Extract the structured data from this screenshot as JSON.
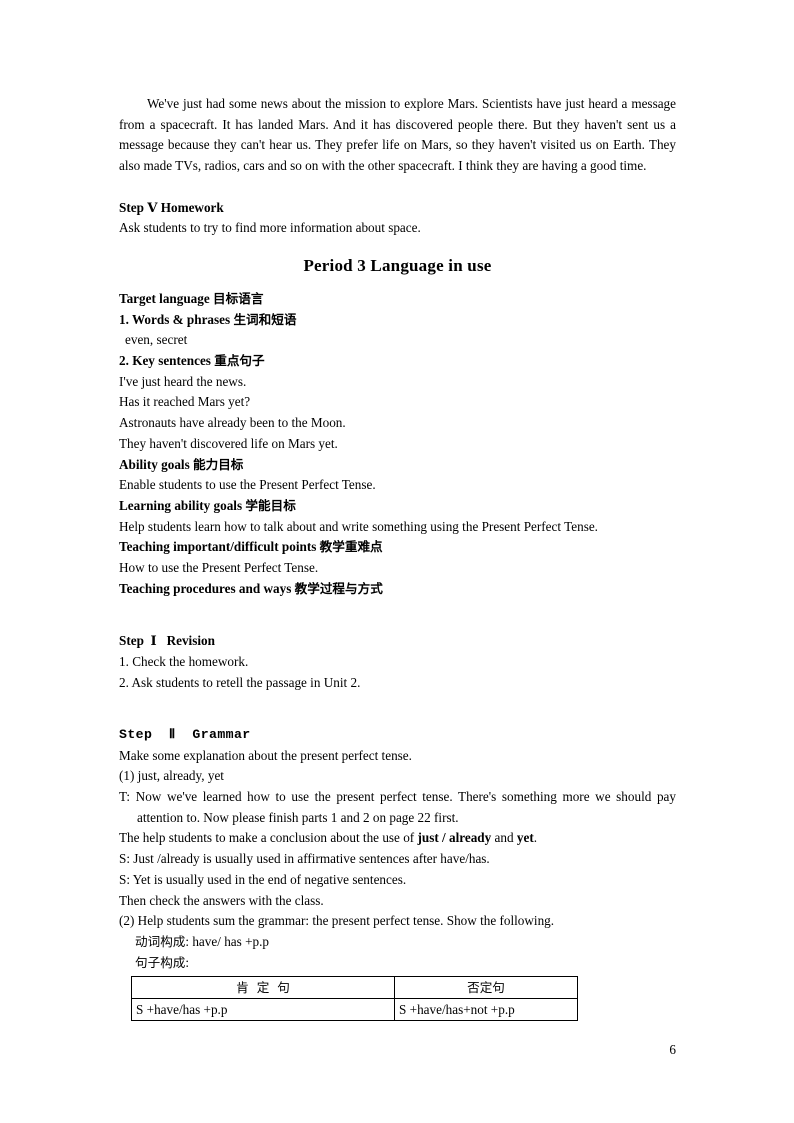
{
  "document": {
    "page_number": "6",
    "intro_paragraph": "We've just had some news about the mission to explore Mars. Scientists have just heard a message from a spacecraft. It has landed Mars. And it has discovered people there. But they haven't sent us a message because they can't hear us. They prefer life on Mars, so they haven't visited us on Earth. They also made TVs, radios, cars and so on with the other spacecraft. I think they are having a good time.",
    "step5": {
      "heading": "Step Ⅴ Homework",
      "body": "Ask students to try to find more information about space."
    },
    "period_title": "Period 3 Language in use",
    "target_language": {
      "heading_en": "Target language ",
      "heading_cn": "目标语言",
      "words_phrases": {
        "heading_en": "1. Words & phrases ",
        "heading_cn": "生词和短语",
        "items": "even, secret"
      },
      "key_sentences": {
        "heading_en": "2. Key sentences ",
        "heading_cn": "重点句子",
        "sentences": [
          "I've just heard the news.",
          "Has it reached Mars yet?",
          "Astronauts have already been to the Moon.",
          "They haven't discovered life on Mars yet."
        ]
      }
    },
    "ability_goals": {
      "heading_en": "Ability goals ",
      "heading_cn": "能力目标",
      "body": "Enable students to use the Present Perfect Tense."
    },
    "learning_ability_goals": {
      "heading_en": "Learning ability goals ",
      "heading_cn": "学能目标",
      "body": "Help students learn how to talk about and write something using the Present Perfect Tense."
    },
    "teaching_points": {
      "heading_en": "Teaching important/difficult points ",
      "heading_cn": "教学重难点",
      "body": "How to use the Present Perfect Tense."
    },
    "teaching_procedures": {
      "heading_en": "Teaching procedures and ways ",
      "heading_cn": "教学过程与方式"
    },
    "step1": {
      "heading": "Step  Ⅰ   Revision",
      "items": [
        "1. Check the homework.",
        "2. Ask students to retell the passage in Unit 2."
      ]
    },
    "step2": {
      "heading": "Step  Ⅱ  Grammar",
      "intro": "Make some explanation about the present perfect tense.",
      "point1": "(1) just, already, yet",
      "teacher_line": "T: Now we've learned how to use the present perfect tense. There's something more we should pay attention to. Now please finish parts 1 and 2 on page 22 first.",
      "conclusion_pre": "The help students to make a conclusion about the use of ",
      "conclusion_bold1": "just / already",
      "conclusion_mid": " and ",
      "conclusion_bold2": "yet",
      "conclusion_end": ".",
      "student_line1": "S: Just /already is usually used in affirmative sentences after have/has.",
      "student_line2": "S: Yet is usually used in the end of negative sentences.",
      "check_line": "Then check the answers with the class.",
      "point2": "(2) Help students sum the grammar: the present perfect tense. Show the following.",
      "verb_form_cn": "动词构成",
      "verb_form_en": ": have/ has +p.p",
      "sentence_form_cn": "句子构成",
      "sentence_form_en": ":",
      "table": {
        "headers": [
          "肯  定  句",
          "否定句"
        ],
        "rows": [
          [
            "S +have/has +p.p",
            "S +have/has+not +p.p"
          ]
        ]
      }
    }
  }
}
